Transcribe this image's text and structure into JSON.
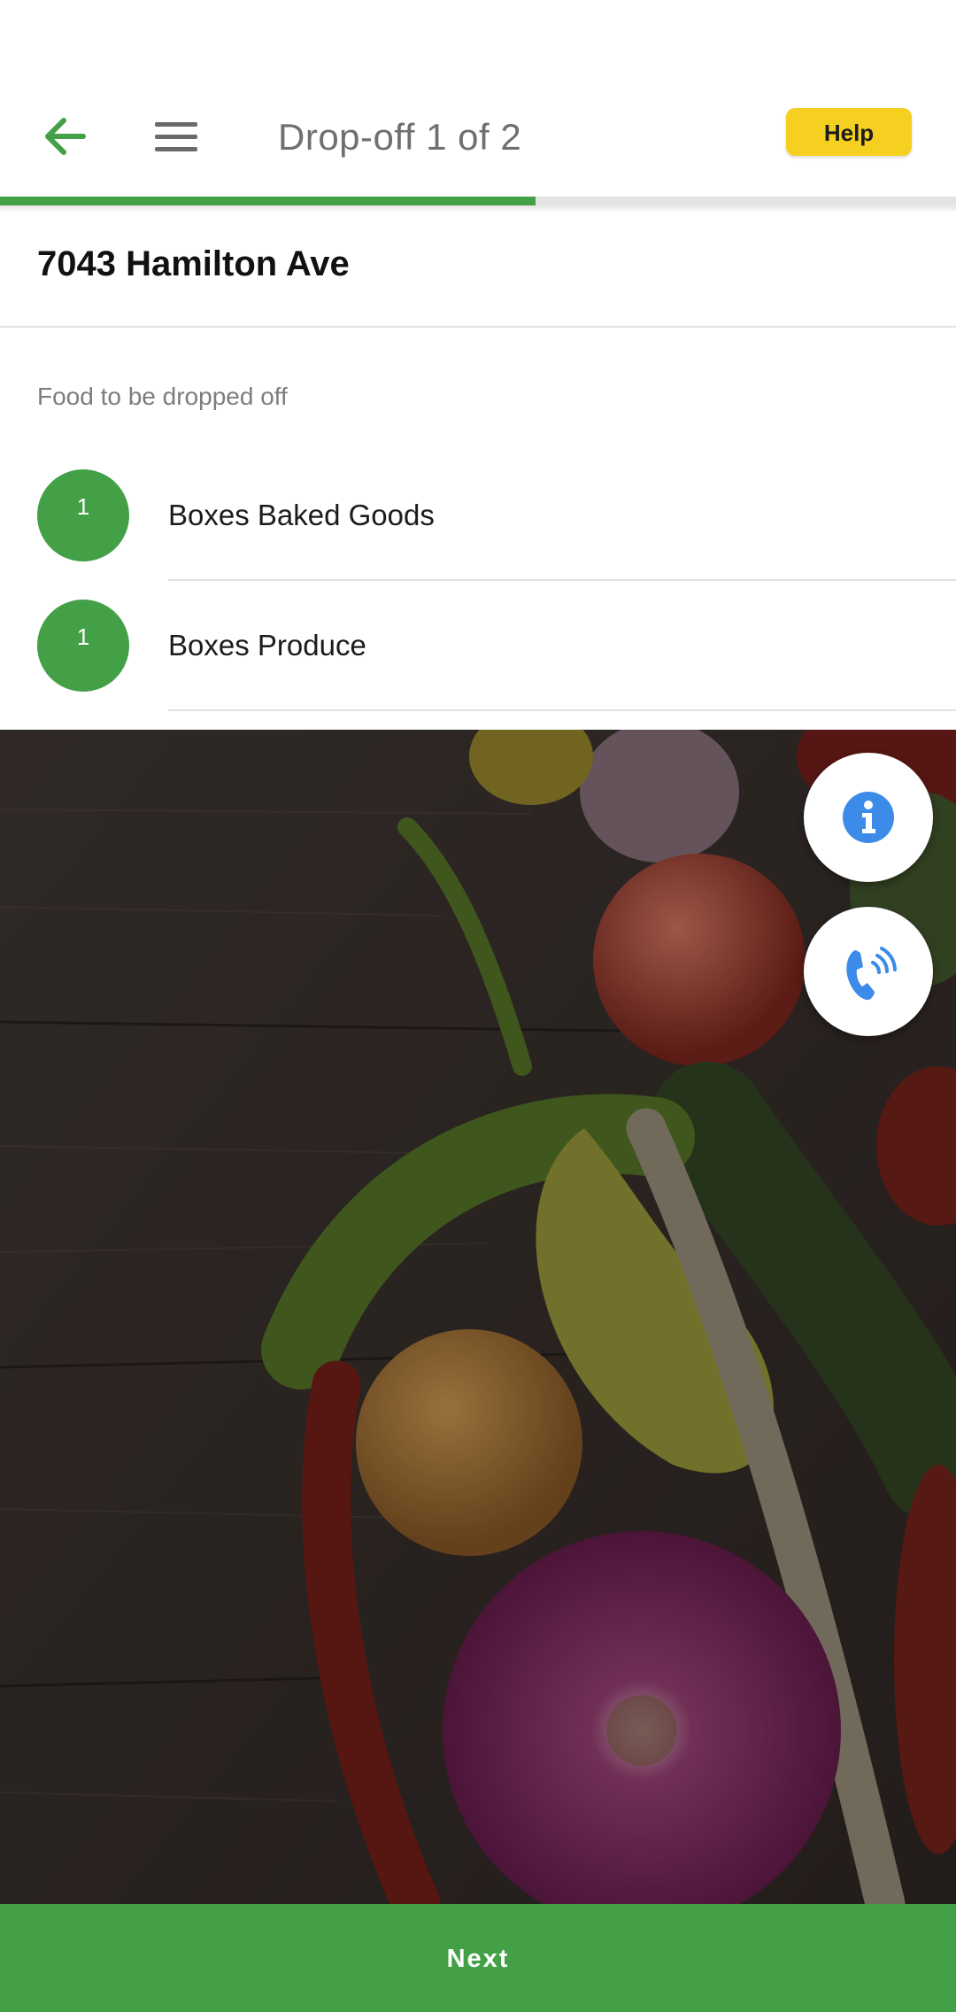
{
  "header": {
    "title": "Drop-off 1 of 2",
    "help_label": "Help",
    "back_icon": "arrow-left-icon",
    "menu_icon": "hamburger-menu-icon"
  },
  "progress": {
    "current": 1,
    "total": 2,
    "fraction": 0.56
  },
  "dropoff": {
    "address": "7043 Hamilton Ave",
    "section_label": "Food to be dropped off",
    "items": [
      {
        "quantity": "1",
        "label": "Boxes Baked Goods"
      },
      {
        "quantity": "1",
        "label": "Boxes Produce"
      }
    ]
  },
  "actions": {
    "info_icon": "info-icon",
    "call_icon": "phone-call-icon",
    "next_label": "Next"
  },
  "colors": {
    "brand_green": "#43a047",
    "help_yellow": "#f5d020",
    "fab_icon_blue": "#3d8be8"
  }
}
